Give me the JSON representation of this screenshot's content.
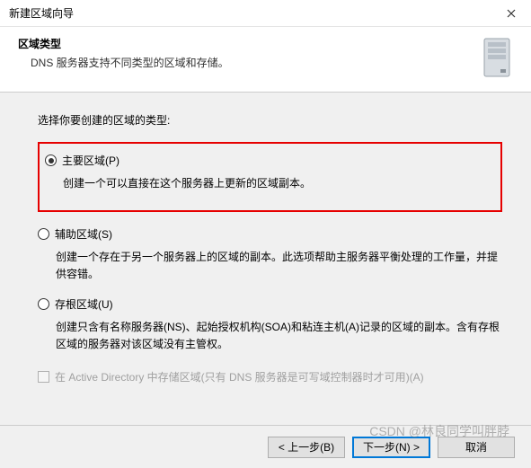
{
  "titlebar": {
    "title": "新建区域向导"
  },
  "header": {
    "title": "区域类型",
    "subtitle": "DNS 服务器支持不同类型的区域和存储。"
  },
  "content": {
    "prompt": "选择你要创建的区域的类型:",
    "options": [
      {
        "label": "主要区域(P)",
        "desc": "创建一个可以直接在这个服务器上更新的区域副本。",
        "selected": true
      },
      {
        "label": "辅助区域(S)",
        "desc": "创建一个存在于另一个服务器上的区域的副本。此选项帮助主服务器平衡处理的工作量，并提供容错。",
        "selected": false
      },
      {
        "label": "存根区域(U)",
        "desc": "创建只含有名称服务器(NS)、起始授权机构(SOA)和粘连主机(A)记录的区域的副本。含有存根区域的服务器对该区域没有主管权。",
        "selected": false
      }
    ],
    "checkbox": {
      "label": "在 Active Directory 中存储区域(只有 DNS 服务器是可写域控制器时才可用)(A)"
    }
  },
  "footer": {
    "back": "< 上一步(B)",
    "next": "下一步(N) >",
    "cancel": "取消"
  },
  "watermark": "CSDN @林良同学叫胖脖"
}
